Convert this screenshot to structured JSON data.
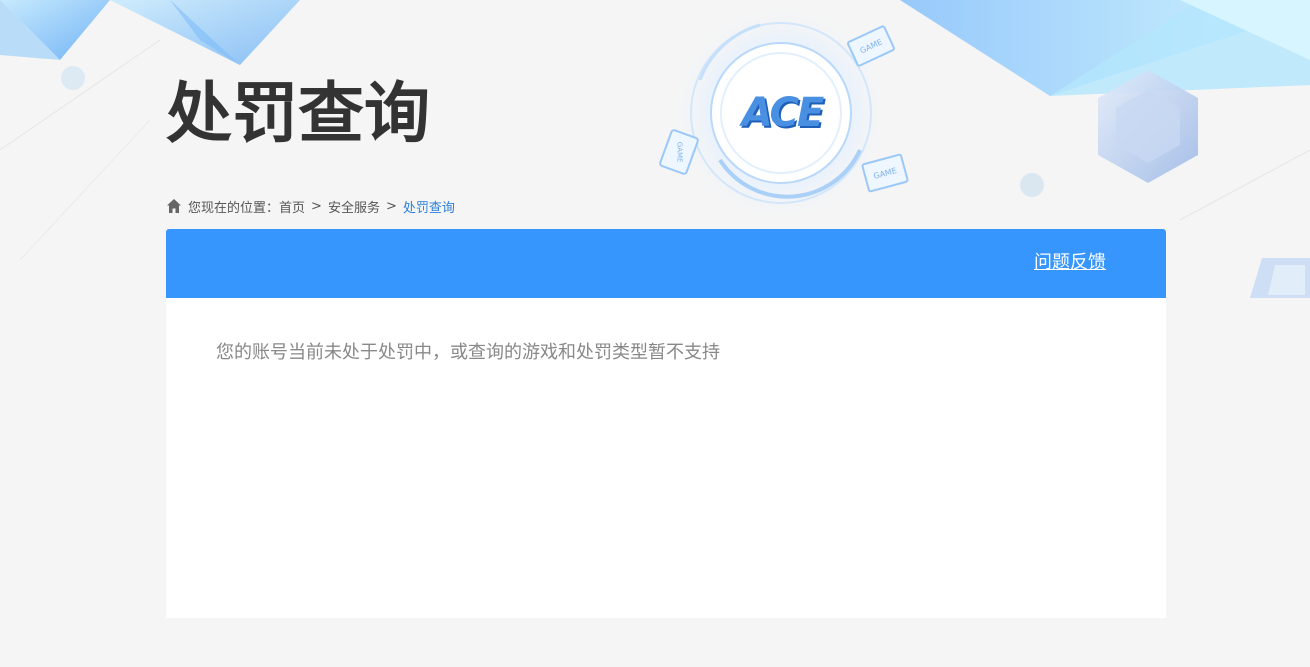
{
  "page": {
    "title": "处罚查询"
  },
  "breadcrumb": {
    "prefix": "您现在的位置：",
    "items": [
      {
        "label": "首页"
      },
      {
        "label": "安全服务"
      }
    ],
    "separator": ">",
    "current": "处罚查询"
  },
  "panel": {
    "feedback_label": "问题反馈",
    "message": "您的账号当前未处于处罚中，或查询的游戏和处罚类型暂不支持"
  },
  "logo": {
    "text": "ACE",
    "badge_text": "GAME"
  },
  "colors": {
    "header_blue": "#3796fd",
    "current_crumb": "#2d7fd8",
    "title": "#333333",
    "message": "#888888"
  }
}
